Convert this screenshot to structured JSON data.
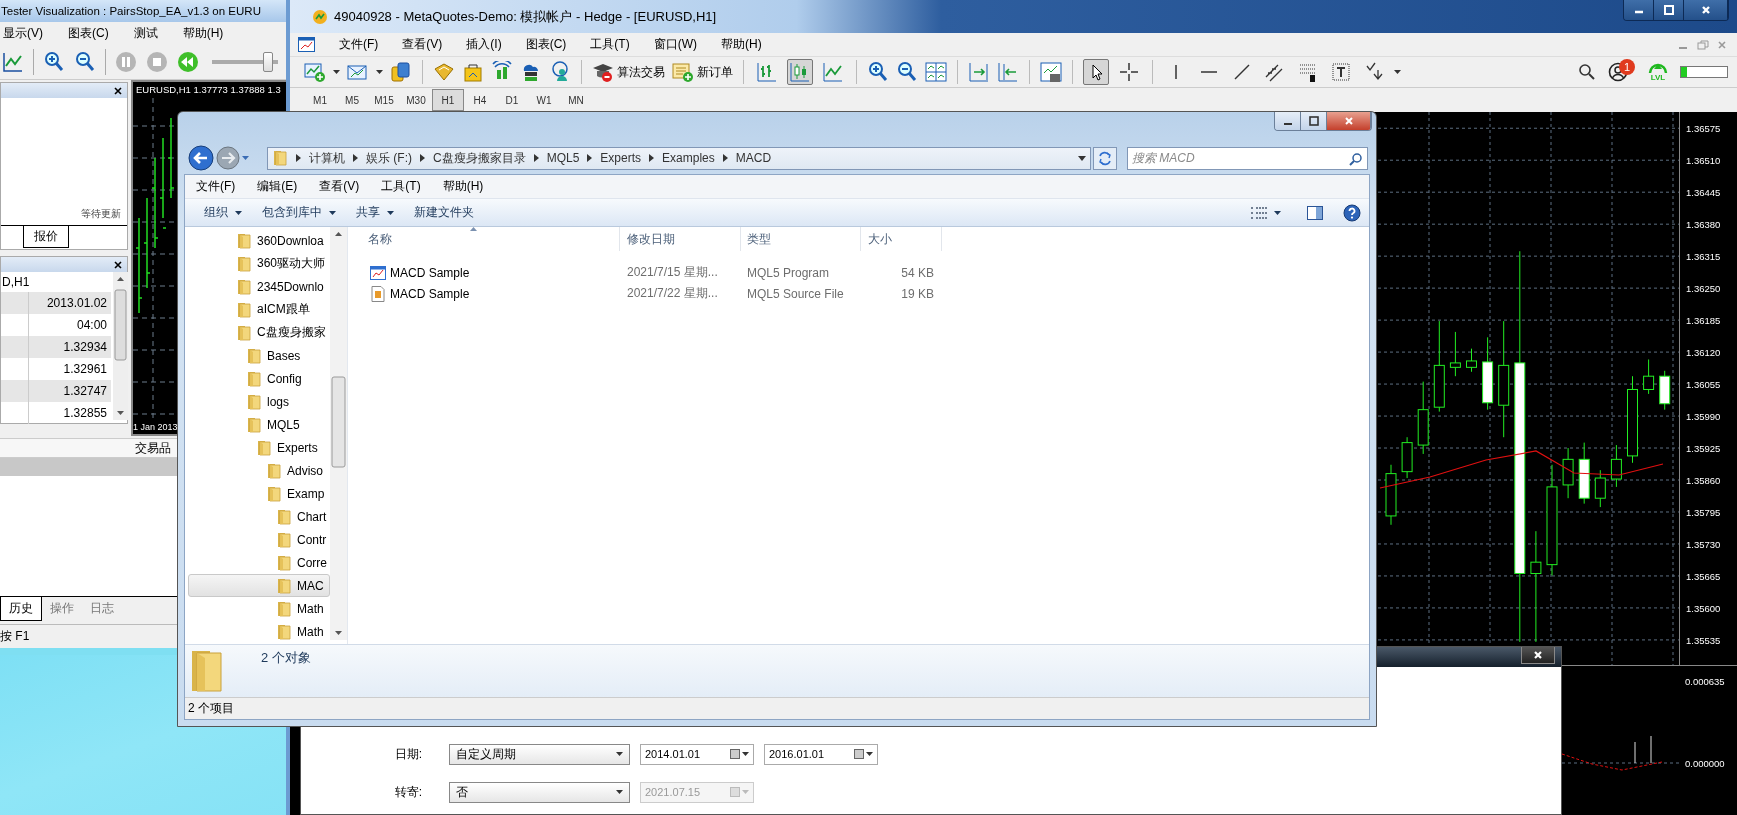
{
  "tester_window": {
    "title": "Tester Visualization : PairsStop_EA_v1.3 on EURU",
    "menu": [
      "显示(V)",
      "图表(C)",
      "测试",
      "帮助(H)"
    ],
    "speed_slider": {
      "level": 0.85
    },
    "quote_panel": {
      "status": "等待更新",
      "tabs": [
        {
          "label": "报价",
          "selected": true
        }
      ]
    },
    "data_panel": {
      "symbol": "D,H1",
      "values": [
        "2013.01.02",
        "04:00",
        "1.32934",
        "1.32961",
        "1.32747",
        "1.32855"
      ]
    },
    "chart": {
      "header": "EURUSD,H1  1.37773 1.37888 1.3",
      "date": "1 Jan 2013"
    },
    "column_header": "交易品",
    "tabs": [
      {
        "label": "历史",
        "selected": true
      },
      {
        "label": "操作",
        "selected": false
      },
      {
        "label": "日志",
        "selected": false
      }
    ],
    "status_bar": "按 F1"
  },
  "main_window": {
    "title": "49040928 - MetaQuotes-Demo: 模拟帐户 - Hedge - [EURUSD,H1]",
    "menu": [
      "文件(F)",
      "查看(V)",
      "插入(I)",
      "图表(C)",
      "工具(T)",
      "窗口(W)",
      "帮助(H)"
    ],
    "toolbar": {
      "algo_trading": "算法交易",
      "new_order": "新订单",
      "chart_types": [
        {
          "selected": false
        },
        {
          "selected": true
        },
        {
          "selected": false
        }
      ],
      "tools": [
        {
          "selected": true
        },
        {
          "selected": false
        },
        {
          "selected": false
        },
        {
          "selected": false
        },
        {
          "selected": false
        },
        {
          "selected": false
        },
        {
          "selected": false
        },
        {
          "selected": false
        },
        {
          "selected": false
        }
      ]
    },
    "notification_badge": "1",
    "level_badge": "LVL",
    "level_meter": {
      "level": 0.12
    },
    "timeframes": [
      {
        "label": "M1",
        "selected": false
      },
      {
        "label": "M5",
        "selected": false
      },
      {
        "label": "M15",
        "selected": false
      },
      {
        "label": "M30",
        "selected": false
      },
      {
        "label": "H1",
        "selected": true
      },
      {
        "label": "H4",
        "selected": false
      },
      {
        "label": "D1",
        "selected": false
      },
      {
        "label": "W1",
        "selected": false
      },
      {
        "label": "MN",
        "selected": false
      }
    ],
    "chart_data": {
      "type": "candlestick",
      "grid": true,
      "ylim": [
        1.35484,
        1.36608
      ],
      "ohlc": [
        [
          1.35787,
          1.35891,
          1.35769,
          1.35873
        ],
        [
          1.35877,
          1.35947,
          1.35864,
          1.35936
        ],
        [
          1.35931,
          1.3606,
          1.35913,
          1.36003
        ],
        [
          1.36008,
          1.36183,
          1.35999,
          1.36093
        ],
        [
          1.36089,
          1.36161,
          1.36071,
          1.36098
        ],
        [
          1.36089,
          1.36127,
          1.3608,
          1.36102
        ],
        [
          1.361,
          1.3615,
          1.36003,
          1.36017
        ],
        [
          1.36012,
          1.36183,
          1.35947,
          1.36093
        ],
        [
          1.36098,
          1.36325,
          1.35531,
          1.3567
        ],
        [
          1.3567,
          1.35756,
          1.35531,
          1.35693
        ],
        [
          1.35688,
          1.35891,
          1.35666,
          1.35846
        ],
        [
          1.3585,
          1.35925,
          1.35823,
          1.35902
        ],
        [
          1.35902,
          1.35936,
          1.35812,
          1.35823
        ],
        [
          1.35823,
          1.3588,
          1.35805,
          1.35864
        ],
        [
          1.35862,
          1.35931,
          1.35846,
          1.35902
        ],
        [
          1.35909,
          1.36071,
          1.35895,
          1.36044
        ],
        [
          1.36044,
          1.36105,
          1.36035,
          1.36071
        ],
        [
          1.36071,
          1.36082,
          1.36003,
          1.36015
        ]
      ],
      "yticks": [
        {
          "value": 1.36575,
          "label": "1.36575"
        },
        {
          "value": 1.3651,
          "label": "1.36510"
        },
        {
          "value": 1.36445,
          "label": "1.36445"
        },
        {
          "value": 1.3638,
          "label": "1.36380"
        },
        {
          "value": 1.36315,
          "label": "1.36315"
        },
        {
          "value": 1.3625,
          "label": "1.36250"
        },
        {
          "value": 1.36185,
          "label": "1.36185"
        },
        {
          "value": 1.3612,
          "label": "1.36120"
        },
        {
          "value": 1.36055,
          "label": "1.36055"
        },
        {
          "value": 1.3599,
          "label": "1.35990"
        },
        {
          "value": 1.35925,
          "label": "1.35925"
        },
        {
          "value": 1.3586,
          "label": "1.35860"
        },
        {
          "value": 1.35795,
          "label": "1.35795"
        },
        {
          "value": 1.3573,
          "label": "1.35730"
        },
        {
          "value": 1.35665,
          "label": "1.35665"
        },
        {
          "value": 1.356,
          "label": "1.35600"
        },
        {
          "value": 1.35535,
          "label": "1.35535"
        }
      ]
    },
    "indicator_axis": [
      "0.000635",
      "0.000000"
    ]
  },
  "tester_settings": {
    "rows": [
      {
        "label": "日期:",
        "select": "自定义周期",
        "dates": [
          {
            "value": "2014.01.01",
            "disabled": false
          },
          {
            "value": "2016.01.01",
            "disabled": false
          }
        ]
      },
      {
        "label": "转寄:",
        "select": "否",
        "dates": [
          {
            "value": "2021.07.15",
            "disabled": true
          }
        ]
      }
    ]
  },
  "explorer": {
    "breadcrumbs": [
      "计算机",
      "娱乐 (F:)",
      "C盘瘦身搬家目录",
      "MQL5",
      "Experts",
      "Examples",
      "MACD"
    ],
    "search": {
      "placeholder": "搜索 MACD"
    },
    "menu": [
      "文件(F)",
      "编辑(E)",
      "查看(V)",
      "工具(T)",
      "帮助(H)"
    ],
    "commands": [
      {
        "label": "组织",
        "dropdown": true
      },
      {
        "label": "包含到库中",
        "dropdown": true
      },
      {
        "label": "共享",
        "dropdown": true
      },
      {
        "label": "新建文件夹",
        "dropdown": false
      }
    ],
    "tree": [
      {
        "label": "360Downloa",
        "selected": false
      },
      {
        "label": "360驱动大师",
        "selected": false
      },
      {
        "label": "2345Downlo",
        "selected": false
      },
      {
        "label": "aICM跟单",
        "selected": false
      },
      {
        "label": "C盘瘦身搬家",
        "selected": false,
        "children": [
          {
            "label": "Bases",
            "selected": false
          },
          {
            "label": "Config",
            "selected": false
          },
          {
            "label": "logs",
            "selected": false
          },
          {
            "label": "MQL5",
            "selected": false,
            "children": [
              {
                "label": "Experts",
                "selected": false,
                "children": [
                  {
                    "label": "Adviso",
                    "selected": false
                  },
                  {
                    "label": "Examp",
                    "selected": false,
                    "children": [
                      {
                        "label": "Chart",
                        "selected": false
                      },
                      {
                        "label": "Contr",
                        "selected": false
                      },
                      {
                        "label": "Corre",
                        "selected": false
                      },
                      {
                        "label": "MAC",
                        "selected": true
                      },
                      {
                        "label": "Math",
                        "selected": false
                      },
                      {
                        "label": "Math",
                        "selected": false
                      }
                    ]
                  }
                ]
              }
            ]
          }
        ]
      }
    ],
    "columns": [
      "名称",
      "修改日期",
      "类型",
      "大小"
    ],
    "files": [
      {
        "kind": "program",
        "name": "MACD Sample",
        "modified": "2021/7/15 星期...",
        "type": "MQL5 Program",
        "size": "54 KB"
      },
      {
        "kind": "source",
        "name": "MACD Sample",
        "modified": "2021/7/22 星期...",
        "type": "MQL5 Source File",
        "size": "19 KB"
      }
    ],
    "details": "2 个对象",
    "status_bar": "2 个项目"
  }
}
